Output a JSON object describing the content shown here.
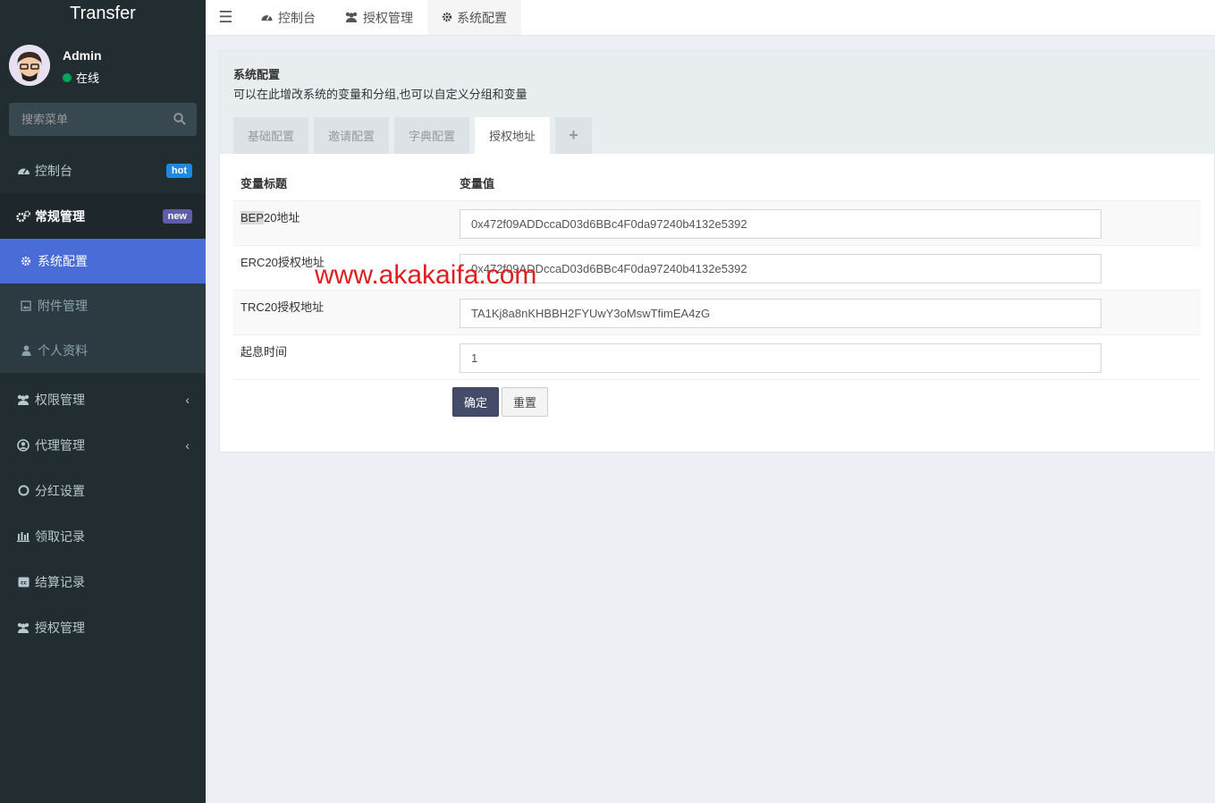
{
  "app": {
    "title": "Transfer"
  },
  "user": {
    "name": "Admin",
    "status": "在线"
  },
  "search": {
    "placeholder": "搜索菜单"
  },
  "sidebar": {
    "items": [
      {
        "label": "控制台",
        "icon": "dashboard-icon",
        "badge": "hot",
        "badge_color": "#1e88e5"
      },
      {
        "label": "常规管理",
        "icon": "cogs-icon",
        "badge": "new",
        "badge_color": "#605ca8"
      }
    ],
    "submenu": [
      {
        "label": "系统配置",
        "icon": "gear-icon"
      },
      {
        "label": "附件管理",
        "icon": "image-icon"
      },
      {
        "label": "个人资料",
        "icon": "user-icon"
      }
    ],
    "rest": [
      {
        "label": "权限管理",
        "icon": "group-icon",
        "chevron": "‹"
      },
      {
        "label": "代理管理",
        "icon": "user-circle-icon",
        "chevron": "‹"
      },
      {
        "label": "分红设置",
        "icon": "circle-icon"
      },
      {
        "label": "领取记录",
        "icon": "chart-icon"
      },
      {
        "label": "结算记录",
        "icon": "cc-icon"
      },
      {
        "label": "授权管理",
        "icon": "group-icon"
      }
    ]
  },
  "topnav": {
    "tabs": [
      {
        "label": "控制台",
        "icon": "dashboard-icon"
      },
      {
        "label": "授权管理",
        "icon": "group-icon"
      },
      {
        "label": "系统配置",
        "icon": "gear-icon"
      }
    ]
  },
  "panel": {
    "title": "系统配置",
    "desc": "可以在此增改系统的变量和分组,也可以自定义分组和变量",
    "tabs": [
      "基础配置",
      "邀请配置",
      "字典配置",
      "授权地址"
    ],
    "add_tab": "+"
  },
  "table": {
    "headers": [
      "变量标题",
      "变量值"
    ],
    "rows": [
      {
        "title_hl": "BEP",
        "title_rest": "20地址",
        "value": "0x472f09ADDccaD03d6BBc4F0da97240b4132e5392"
      },
      {
        "title": "ERC20授权地址",
        "value": "0x472f09ADDccaD03d6BBc4F0da97240b4132e5392"
      },
      {
        "title": "TRC20授权地址",
        "value": "TA1Kj8a8nKHBBH2FYUwY3oMswTfimEA4zG"
      },
      {
        "title": "起息时间",
        "value": "1"
      }
    ],
    "ok_label": "确定",
    "reset_label": "重置"
  },
  "watermark": "www.akakaifa.com",
  "colors": {
    "sidebar_bg": "#222d32",
    "active": "#4a6cd6",
    "ok_button": "#444c69"
  }
}
